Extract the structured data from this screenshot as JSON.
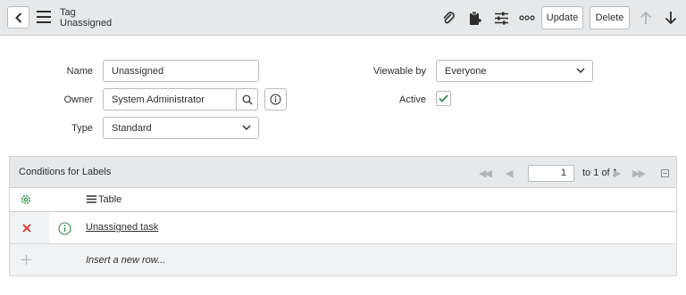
{
  "header": {
    "record_type": "Tag",
    "record_name": "Unassigned",
    "update_label": "Update",
    "delete_label": "Delete",
    "icons": [
      "back-icon",
      "menu-icon",
      "attachment-icon",
      "clipboard-icon",
      "settings-sliders-icon",
      "more-icon",
      "arrow-up-icon",
      "arrow-down-icon"
    ]
  },
  "form": {
    "name_label": "Name",
    "name_value": "Unassigned",
    "owner_label": "Owner",
    "owner_value": "System Administrator",
    "type_label": "Type",
    "type_value": "Standard",
    "viewable_label": "Viewable by",
    "viewable_value": "Everyone",
    "active_label": "Active",
    "active_checked": true
  },
  "related_list": {
    "title": "Conditions for Labels",
    "page_value": "1",
    "page_text": "to 1 of 1",
    "column_header": "Table",
    "rows": [
      {
        "link": "Unassigned task"
      }
    ],
    "insert_text": "Insert a new row..."
  },
  "colors": {
    "header_bg": "#e6e8ea",
    "delete_red": "#d9342b",
    "check_green": "#2f8c48",
    "info_green": "#2f8c48"
  }
}
